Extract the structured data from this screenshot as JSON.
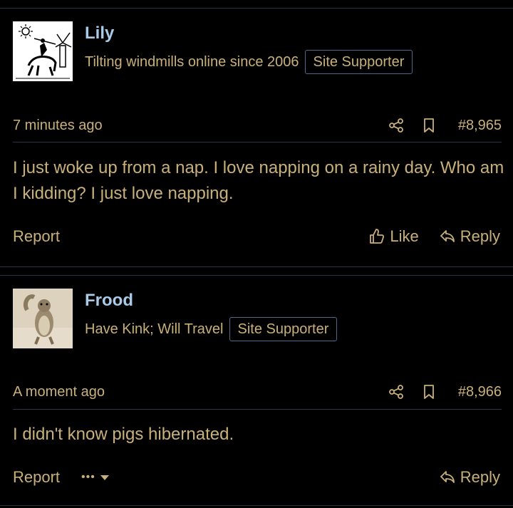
{
  "posts": [
    {
      "username": "Lily",
      "user_title": "Tilting windmills online since 2006",
      "badge": "Site Supporter",
      "time": "7 minutes ago",
      "post_number": "#8,965",
      "text": "I just woke up from a nap. I love napping on a rainy day. Who am I kidding? I just love napping.",
      "report_label": "Report",
      "like_label": "Like",
      "reply_label": "Reply"
    },
    {
      "username": "Frood",
      "user_title": "Have Kink; Will Travel",
      "badge": "Site Supporter",
      "time": "A moment ago",
      "post_number": "#8,966",
      "text": "I didn't know pigs hibernated.",
      "report_label": "Report",
      "more_label": "•••",
      "reply_label": "Reply"
    }
  ]
}
